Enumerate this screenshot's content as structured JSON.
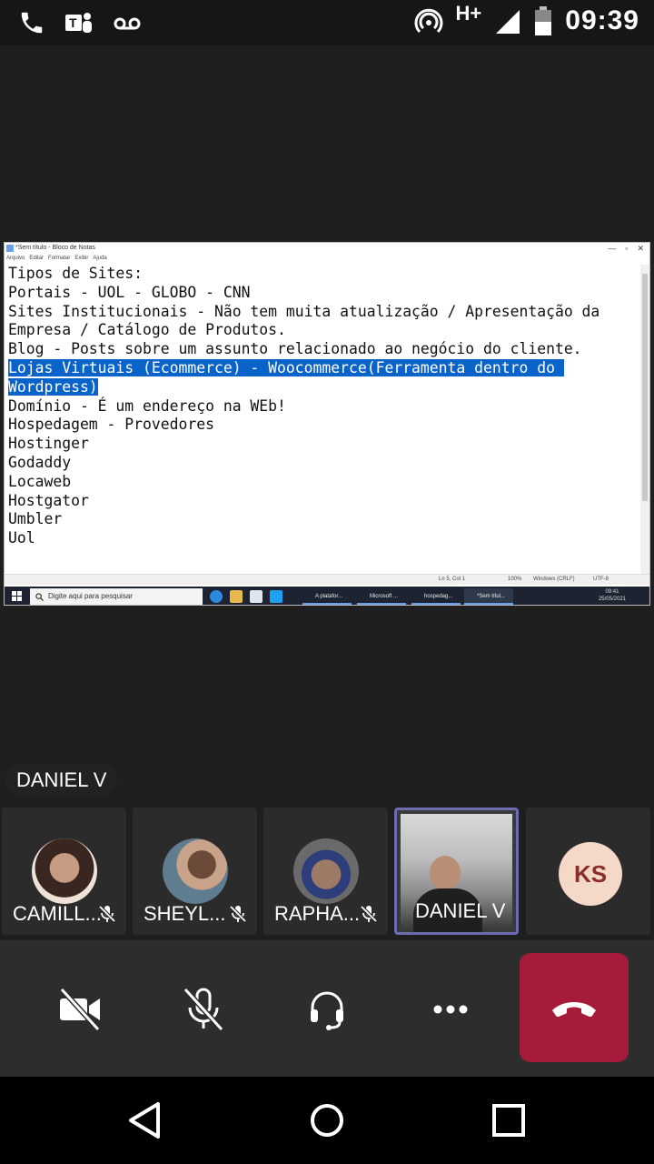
{
  "status_bar": {
    "left_icons": [
      "phone-icon",
      "teams-icon",
      "voicemail-icon"
    ],
    "network": "H+",
    "time": "09:39",
    "right_icons": [
      "hotspot-icon",
      "signal-icon",
      "battery-icon"
    ]
  },
  "shared_screen": {
    "window_title": "*Sem título - Bloco de Notas",
    "menu": [
      "Arquivo",
      "Editar",
      "Formatar",
      "Exibir",
      "Ajuda"
    ],
    "lines_before_selection": [
      "Tipos de Sites:",
      "Portais - UOL - GLOBO - CNN",
      "Sites Institucionais - Não tem muita atualização / Apresentação da",
      "Empresa / Catálogo de Produtos.",
      "Blog - Posts sobre um assunto relacionado ao negócio do cliente."
    ],
    "selected_lines": [
      "Lojas Virtuais (Ecommerce) - Woocommerce(Ferramenta dentro do ",
      "Wordpress)"
    ],
    "lines_after_selection": [
      "",
      "Domínio - É um endereço na WEb!",
      "Hospedagem - Provedores",
      "",
      "Hostinger",
      "Godaddy",
      "Locaweb",
      "Hostgator",
      "Umbler",
      "Uol"
    ],
    "statusbar": {
      "position": "Ln 5, Col 1",
      "zoom": "100%",
      "line_ending": "Windows (CRLF)",
      "encoding": "UTF-8"
    },
    "taskbar": {
      "search_placeholder": "Digite aqui para pesquisar",
      "windows": [
        "A platafor...",
        "Microsoft ...",
        "hospedag...",
        "*Sem títul..."
      ],
      "clock_time": "09:41",
      "clock_date": "25/05/2021"
    }
  },
  "speaker_label": "DANIEL V",
  "participants": [
    {
      "name": "CAMILL...",
      "muted": true
    },
    {
      "name": "SHEYL...",
      "muted": true
    },
    {
      "name": "RAPHA...",
      "muted": true
    },
    {
      "name": "DANIEL V",
      "muted": false,
      "active": true
    },
    {
      "name": "",
      "initials": "KS"
    }
  ],
  "controls": [
    "camera-off-icon",
    "mic-off-icon",
    "headset-icon",
    "more-icon",
    "hangup-icon"
  ],
  "colors": {
    "hangup": "#a51c3a",
    "active_border": "#6d6cb3",
    "selection": "#0a63c9",
    "ks_avatar": "#f4d9c9"
  }
}
